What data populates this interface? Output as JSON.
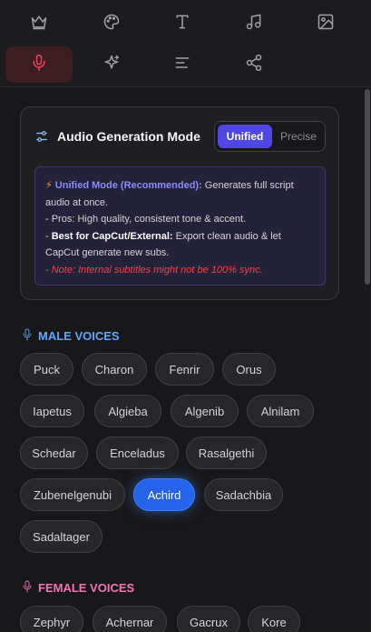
{
  "toolbar": {
    "tabs": [
      {
        "icon": "crown-icon"
      },
      {
        "icon": "palette-icon"
      },
      {
        "icon": "text-icon"
      },
      {
        "icon": "music-icon"
      },
      {
        "icon": "image-icon"
      },
      {
        "icon": "microphone-icon",
        "active": true
      },
      {
        "icon": "sparkles-icon"
      },
      {
        "icon": "align-left-icon"
      },
      {
        "icon": "share-icon"
      }
    ]
  },
  "mode": {
    "title": "Audio Generation Mode",
    "options": [
      "Unified",
      "Precise"
    ],
    "selected": "Unified",
    "info": {
      "bolt": "⚡",
      "headline": "Unified Mode (Recommended):",
      "headline_rest": " Generates full script audio at once.",
      "pros": "- Pros: High quality, consistent tone & accent.",
      "best_prefix": "- ",
      "best_label": "Best for CapCut/External:",
      "best_rest": " Export clean audio & let CapCut generate new subs.",
      "note": "- Note: Internal subtitles might not be 100% sync."
    }
  },
  "male_voices": {
    "heading": "MALE VOICES",
    "voices": [
      "Puck",
      "Charon",
      "Fenrir",
      "Orus",
      "Iapetus",
      "Algieba",
      "Algenib",
      "Alnilam",
      "Schedar",
      "Enceladus",
      "Rasalgethi",
      "Zubenelgenubi",
      "Achird",
      "Sadachbia",
      "Sadaltager"
    ],
    "selected": "Achird"
  },
  "female_voices": {
    "heading": "FEMALE VOICES",
    "voices": [
      "Zephyr",
      "Achernar",
      "Gacrux",
      "Kore"
    ]
  },
  "colors": {
    "accent": "#4f46e5",
    "selected_voice": "#2563eb",
    "male": "#60a5fa",
    "female": "#f472b6",
    "active_tab": "#f43f5e"
  }
}
